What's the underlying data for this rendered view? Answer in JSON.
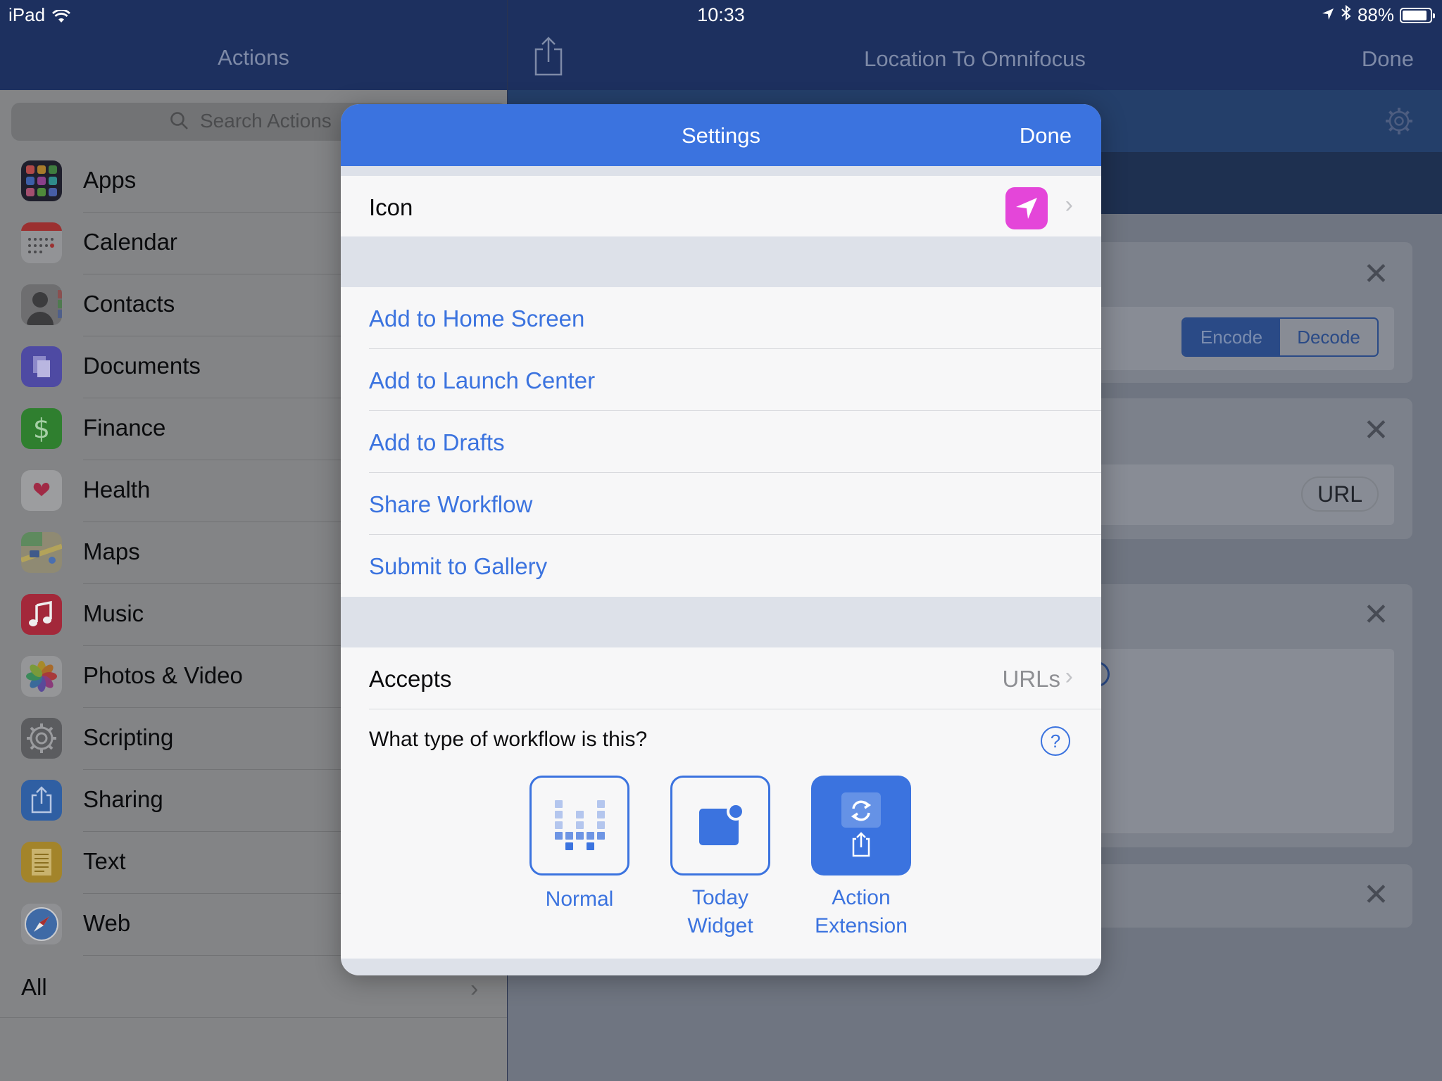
{
  "status_bar": {
    "device": "iPad",
    "time": "10:33",
    "battery": "88%"
  },
  "left_pane": {
    "title": "Actions",
    "search_placeholder": "Search Actions",
    "categories": [
      {
        "label": "Apps",
        "icon": "apps-icon"
      },
      {
        "label": "Calendar",
        "icon": "calendar-icon"
      },
      {
        "label": "Contacts",
        "icon": "contacts-icon"
      },
      {
        "label": "Documents",
        "icon": "documents-icon"
      },
      {
        "label": "Finance",
        "icon": "finance-icon"
      },
      {
        "label": "Health",
        "icon": "health-icon"
      },
      {
        "label": "Maps",
        "icon": "maps-icon"
      },
      {
        "label": "Music",
        "icon": "music-icon"
      },
      {
        "label": "Photos & Video",
        "icon": "photos-icon"
      },
      {
        "label": "Scripting",
        "icon": "scripting-icon"
      },
      {
        "label": "Sharing",
        "icon": "sharing-icon"
      },
      {
        "label": "Text",
        "icon": "text-icon"
      },
      {
        "label": "Web",
        "icon": "web-icon"
      }
    ],
    "all_label": "All"
  },
  "right_pane": {
    "title": "Location To Omnifocus",
    "done_label": "Done",
    "encode_label": "Encode",
    "decode_label": "Decode",
    "url_label": "URL"
  },
  "settings": {
    "title": "Settings",
    "done_label": "Done",
    "icon_label": "Icon",
    "icon_color": "#e446d9",
    "actions": [
      "Add to Home Screen",
      "Add to Launch Center",
      "Add to Drafts",
      "Share Workflow",
      "Submit to Gallery"
    ],
    "accepts_label": "Accepts",
    "accepts_value": "URLs",
    "question": "What type of workflow is this?",
    "workflow_types": {
      "normal": "Normal",
      "today_widget_line1": "Today",
      "today_widget_line2": "Widget",
      "action_extension_line1": "Action",
      "action_extension_line2": "Extension",
      "selected": "Action Extension"
    }
  },
  "colors": {
    "accent": "#3b73df",
    "nav_bar": "#1d305f"
  }
}
